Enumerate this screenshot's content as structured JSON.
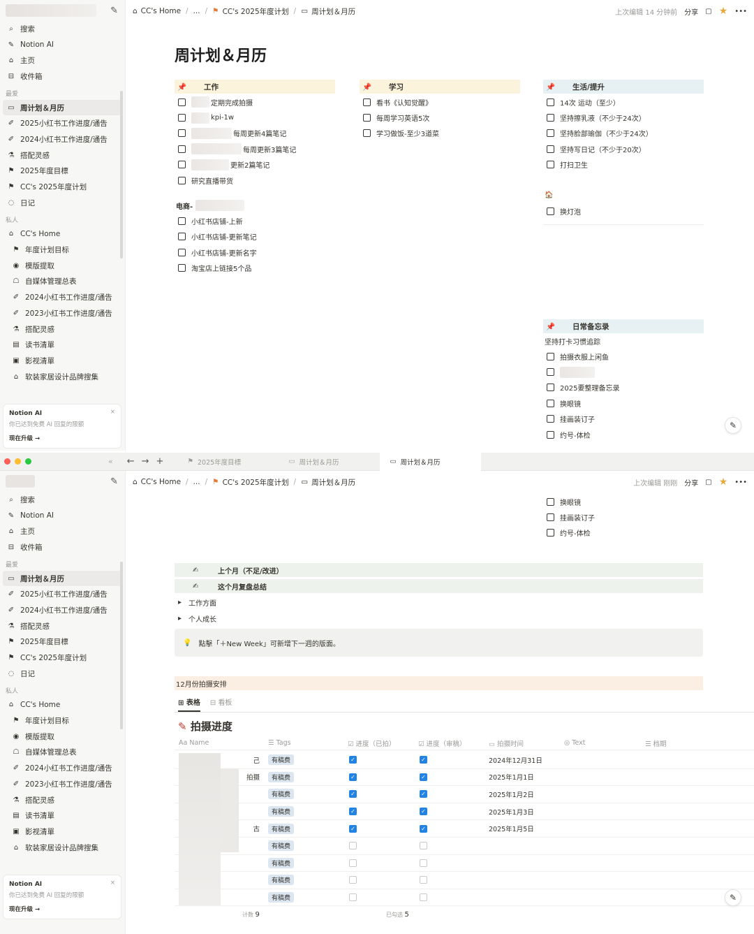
{
  "breadcrumb": {
    "home": "CC's Home",
    "ellipsis": "...",
    "plan": "CC's 2025年度计划",
    "current": "周计划＆月历"
  },
  "topbar": {
    "edited_top": "上次编辑 14 分钟前",
    "edited_bottom": "上次编辑 刚刚",
    "share": "分享"
  },
  "sidebar": {
    "top_items": [
      {
        "icon": "⌕",
        "label": "搜索"
      },
      {
        "icon": "✎",
        "label": "Notion AI"
      },
      {
        "icon": "⌂",
        "label": "主页"
      },
      {
        "icon": "⊟",
        "label": "收件箱"
      }
    ],
    "fav_header": "最爱",
    "favorites": [
      {
        "icon": "▭",
        "label": "周计划＆月历"
      },
      {
        "icon": "✐",
        "label": "2025小红书工作进度/通告"
      },
      {
        "icon": "✐",
        "label": "2024小红书工作进度/通告"
      },
      {
        "icon": "⚗",
        "label": "搭配灵感"
      },
      {
        "icon": "⚑",
        "label": "2025年度目標"
      },
      {
        "icon": "⚑",
        "label": "CC's 2025年度计划"
      },
      {
        "icon": "◌",
        "label": "日记"
      }
    ],
    "private_header": "私人",
    "private": [
      {
        "icon": "⌂",
        "label": "CC's Home"
      },
      {
        "icon": "⚑",
        "label": "年度计划目标"
      },
      {
        "icon": "◉",
        "label": "模版提取"
      },
      {
        "icon": "☖",
        "label": "自媒体管理总表"
      },
      {
        "icon": "✐",
        "label": "2024小红书工作进度/通告"
      },
      {
        "icon": "✐",
        "label": "2023小红书工作进度/通告"
      },
      {
        "icon": "⚗",
        "label": "搭配灵感"
      },
      {
        "icon": "▤",
        "label": "读书清單"
      },
      {
        "icon": "▣",
        "label": "影视清單"
      },
      {
        "icon": "⌂",
        "label": "软装家居设计品牌搜集"
      }
    ],
    "promo": {
      "title": "Notion AI",
      "sub": "你已达到免费 AI 回复的限额",
      "upgrade": "现在升级 →"
    }
  },
  "page": {
    "title": "周计划＆月历",
    "work": {
      "header": "工作",
      "items": [
        "定期完成拍摄",
        "kpi-1w",
        "每周更新4篇笔记",
        "每周更新3篇笔记",
        "更新2篇笔记",
        "研究直播带货"
      ],
      "sub_header": "电商-",
      "sub_items": [
        "小红书店铺-上新",
        "小红书店铺-更新笔记",
        "小红书店铺-更新名字",
        "淘宝店上链接5个品"
      ]
    },
    "study": {
      "header": "学习",
      "items": [
        "看书《认知觉醒》",
        "每周学习英语5次",
        "学习做饭-至少3道菜"
      ]
    },
    "life": {
      "header": "生活/提升",
      "items": [
        "14次  运动（至少）",
        "坚持擦乳液（不少于24次）",
        "坚持脸部瑜伽（不少于24次）",
        "坚持写日记（不少于20次）",
        "打扫卫生"
      ],
      "house_items": [
        "换灯泡"
      ]
    },
    "memo": {
      "header": "日常备忘录",
      "plain": "坚持打卡习惯追踪",
      "items": [
        "拍摄衣服上闲鱼",
        "",
        "2025要整理备忘录",
        "换眼镜",
        "挂画装订子",
        "约号-体检"
      ]
    }
  },
  "tabs": [
    {
      "label": "2025年度目標"
    },
    {
      "label": "周计划＆月历"
    },
    {
      "label": "周计划＆月历"
    }
  ],
  "lower": {
    "memo_tail": [
      "换眼镜",
      "挂画装订子",
      "约号-体检"
    ],
    "bar1": "上个月（不足/改进）",
    "bar2": "这个月复盘总结",
    "toggle1": "工作方面",
    "toggle2": "个人成长",
    "callout": "點擊「＋New Week」可新增下一週的版面。",
    "month_bar": "12月份拍摄安排",
    "view_table": "表格",
    "view_board": "看板",
    "db_title": "拍摄进度",
    "columns": [
      "Aa Name",
      "☰ Tags",
      "☑ 进度（已拍）",
      "☑ 进度（审稿）",
      "▭ 拍摄时间",
      "◎ Text",
      "☰ 档期"
    ],
    "rows": [
      {
        "name": "己",
        "tag": "有稿费",
        "shot": true,
        "review": true,
        "date": "2024年12月31日"
      },
      {
        "name": "拍摄",
        "tag": "有稿费",
        "shot": true,
        "review": true,
        "date": "2025年1月1日"
      },
      {
        "name": "",
        "tag": "有稿费",
        "shot": true,
        "review": true,
        "date": "2025年1月2日"
      },
      {
        "name": "",
        "tag": "有稿费",
        "shot": true,
        "review": true,
        "date": "2025年1月3日"
      },
      {
        "name": "古",
        "tag": "有稿费",
        "shot": true,
        "review": true,
        "date": "2025年1月5日"
      },
      {
        "name": "",
        "tag": "有稿费",
        "shot": false,
        "review": false,
        "date": ""
      },
      {
        "name": "",
        "tag": "有稿费",
        "shot": false,
        "review": false,
        "date": ""
      },
      {
        "name": "",
        "tag": "有稿费",
        "shot": false,
        "review": false,
        "date": ""
      },
      {
        "name": "",
        "tag": "有稿费",
        "shot": false,
        "review": false,
        "date": ""
      }
    ],
    "count_label": "计数",
    "count": "9",
    "checked_label": "已勾选",
    "checked": "5"
  }
}
